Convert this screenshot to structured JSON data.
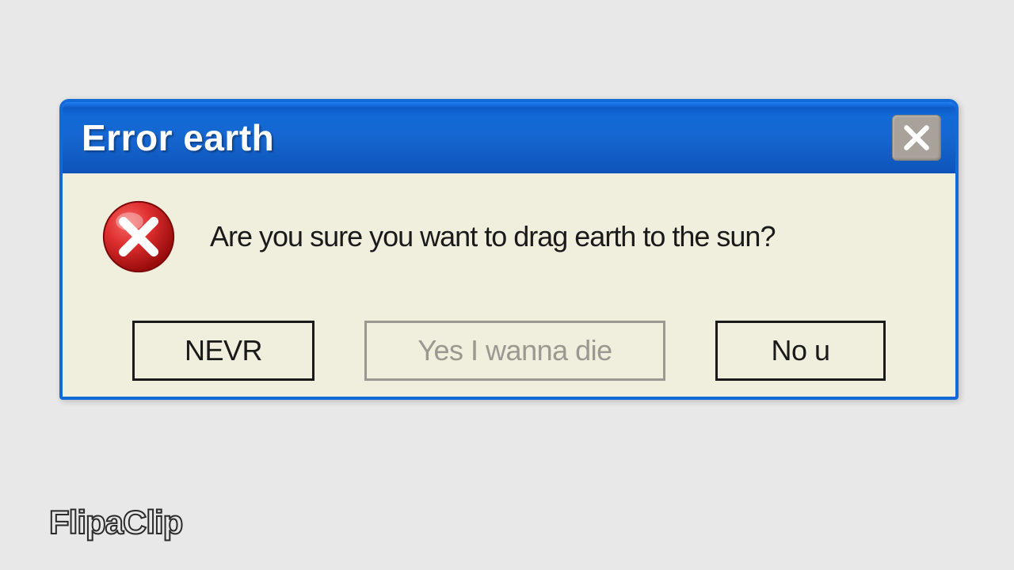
{
  "dialog": {
    "title": "Error earth",
    "message": "Are you sure you want to drag earth to the sun?",
    "buttons": {
      "b1": "NEVR",
      "b2": "Yes I wanna die",
      "b3": "No u"
    }
  },
  "watermark": "FlipaClip",
  "icons": {
    "close": "close-icon",
    "error": "error-icon"
  },
  "colors": {
    "titlebar": "#126ad6",
    "body": "#f0eedd",
    "error_red": "#d32426"
  }
}
